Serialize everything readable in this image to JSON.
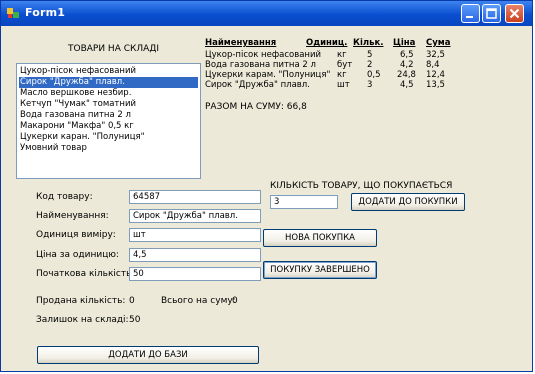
{
  "window": {
    "title": "Form1"
  },
  "stock": {
    "heading": "ТОВАРИ НА СКЛАДІ",
    "items": [
      "Цукор-пісок нефасований",
      "Сирок \"Дружба\" плавл.",
      "Масло вершкове незбир.",
      "Кетчуп \"Чумак\" томатний",
      "Вода газована питна 2 л",
      "Макарони  \"Макфа\" 0,5 кг",
      "Цукерки каран. \"Полуниця\"",
      "Умовний товар"
    ],
    "selected_index": 1
  },
  "purchase": {
    "headers": {
      "name": "Найменування",
      "unit": "Одиниц.",
      "qty": "Кільк.",
      "price": "Ціна",
      "sum": "Сума"
    },
    "rows": [
      {
        "name": "Цукор-пісок нефасований",
        "unit": "кг",
        "qty": "5",
        "price": "6,5",
        "sum": "32,5"
      },
      {
        "name": "Вода газована питна 2 л",
        "unit": "бут",
        "qty": "2",
        "price": "4,2",
        "sum": "8,4"
      },
      {
        "name": "Цукерки карам. \"Полуниця\"",
        "unit": "кг",
        "qty": "0,5",
        "price": "24,8",
        "sum": "12,4"
      },
      {
        "name": "Сирок \"Дружба\" плавл.",
        "unit": "шт",
        "qty": "3",
        "price": "4,5",
        "sum": "13,5"
      }
    ],
    "total_label": "РАЗОМ НА СУМУ: 66,8"
  },
  "product_form": {
    "code_label": "Код товару:",
    "code_value": "64587",
    "name_label": "Найменування:",
    "name_value": "Сирок \"Дружба\" плавл.",
    "unit_label": "Одиниця виміру:",
    "unit_value": "шт",
    "price_label": "Ціна за одиницю:",
    "price_value": "4,5",
    "initial_qty_label": "Початкова кількість:",
    "initial_qty_value": "50",
    "sold_qty_label": "Продана кількість:",
    "sold_qty_value": "0",
    "total_sum_label": "Всього на суму:",
    "total_sum_value": "0",
    "stock_rest_label": "Залишок на складі:",
    "stock_rest_value": "50",
    "add_to_base_label": "ДОДАТИ ДО БАЗИ"
  },
  "purchase_controls": {
    "qty_label": "КІЛЬКІСТЬ ТОВАРУ, ЩО ПОКУПАЄТЬСЯ",
    "qty_value": "3",
    "add_to_purchase_label": "ДОДАТИ ДО ПОКУПКИ",
    "new_purchase_label": "НОВА ПОКУПКА",
    "finish_purchase_label": "ПОКУПКУ ЗАВЕРШЕНО"
  }
}
